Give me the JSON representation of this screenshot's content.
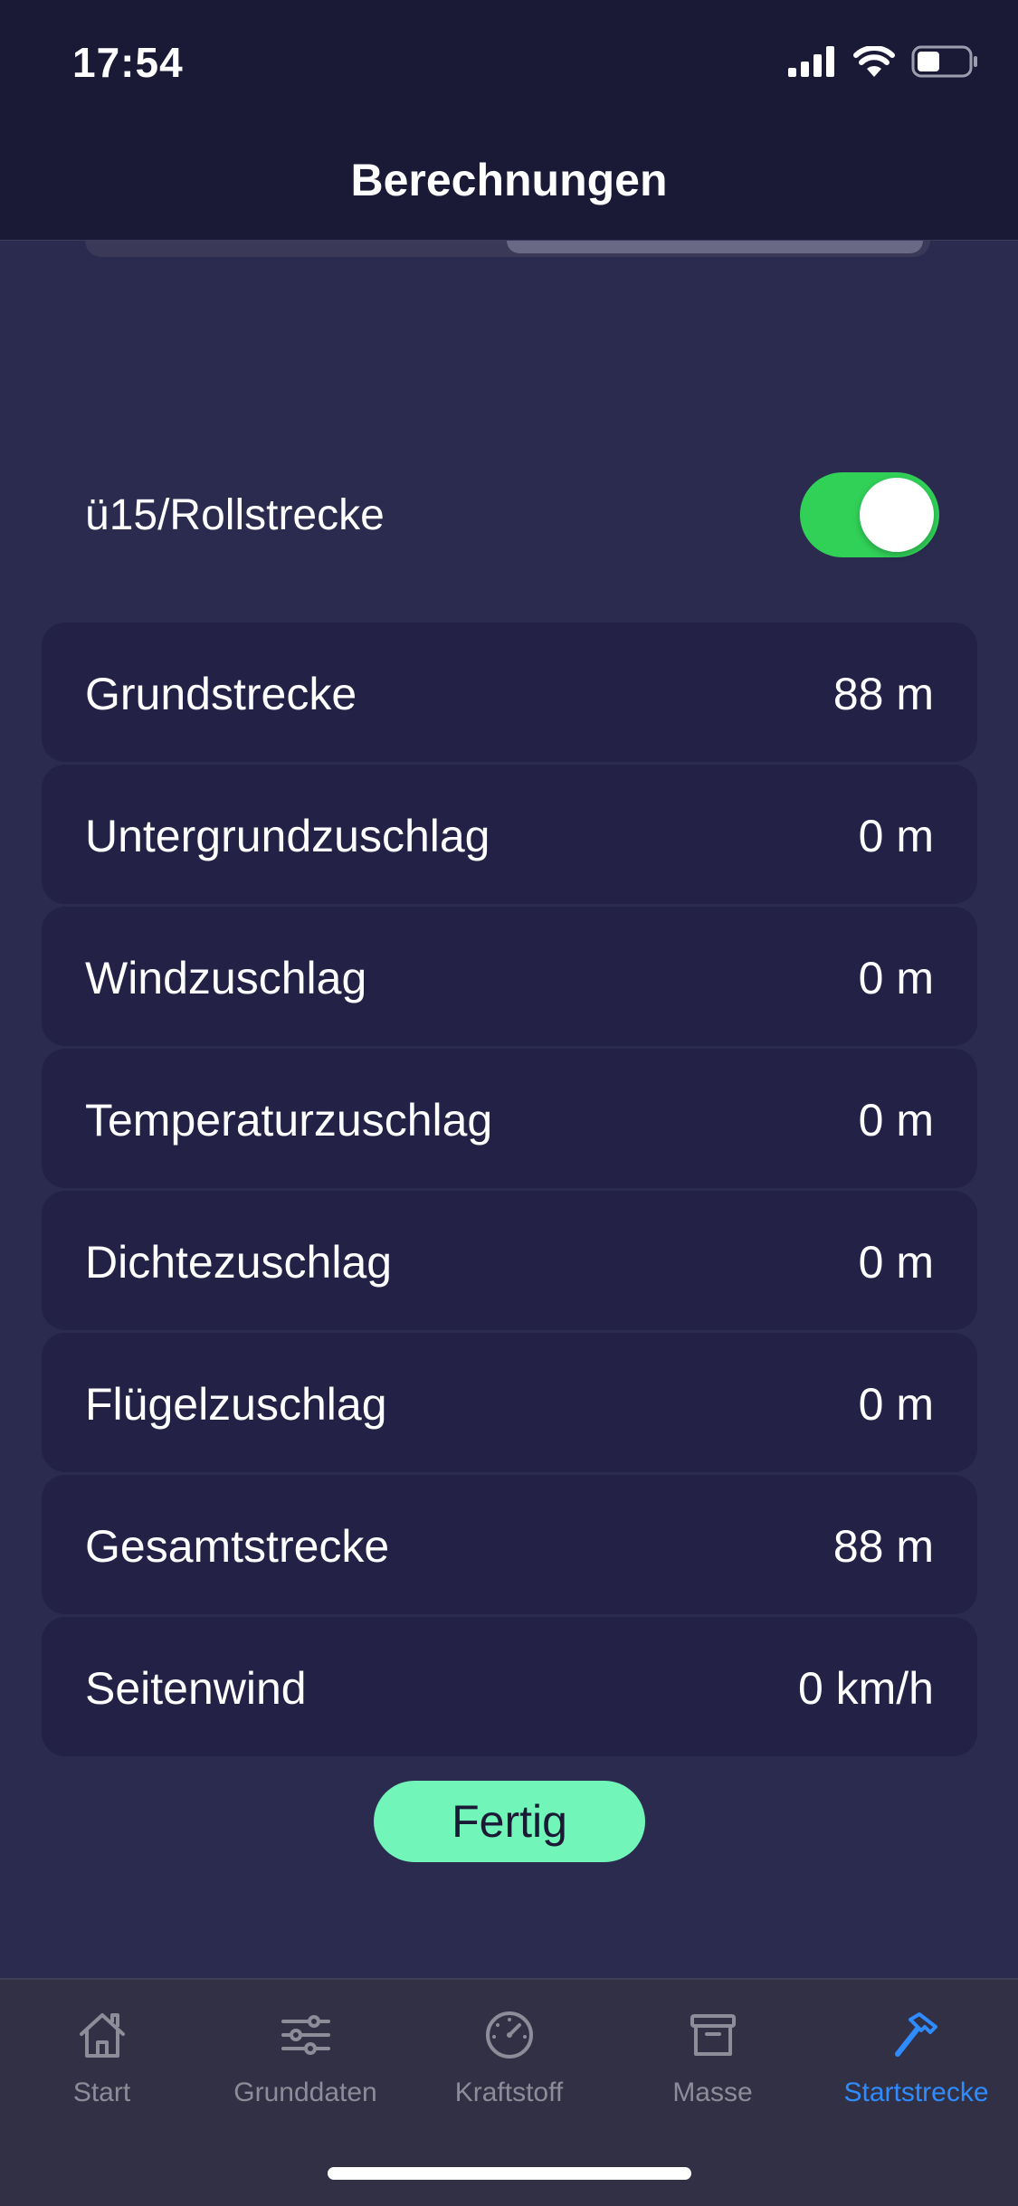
{
  "status_bar": {
    "time": "17:54",
    "icons": [
      "cellular-signal-icon",
      "wifi-icon",
      "battery-icon"
    ]
  },
  "nav": {
    "title": "Berechnungen"
  },
  "toggle": {
    "label": "ü15/Rollstrecke",
    "on": true
  },
  "results": [
    {
      "label": "Grundstrecke",
      "value": "88 m"
    },
    {
      "label": "Untergrundzuschlag",
      "value": "0 m"
    },
    {
      "label": "Windzuschlag",
      "value": "0 m"
    },
    {
      "label": "Temperaturzuschlag",
      "value": "0 m"
    },
    {
      "label": "Dichtezuschlag",
      "value": "0 m"
    },
    {
      "label": "Flügelzuschlag",
      "value": "0 m"
    },
    {
      "label": "Gesamtstrecke",
      "value": "88 m"
    },
    {
      "label": "Seitenwind",
      "value": "0 km/h"
    }
  ],
  "done_button": {
    "label": "Fertig"
  },
  "tabs": [
    {
      "label": "Start",
      "icon": "home-icon",
      "active": false
    },
    {
      "label": "Grunddaten",
      "icon": "sliders-icon",
      "active": false
    },
    {
      "label": "Kraftstoff",
      "icon": "gauge-icon",
      "active": false
    },
    {
      "label": "Masse",
      "icon": "archive-box-icon",
      "active": false
    },
    {
      "label": "Startstrecke",
      "icon": "hammer-icon",
      "active": true
    }
  ],
  "colors": {
    "background": "#2b2a4f",
    "bar_background": "#1b1a36",
    "row_background": "#232246",
    "toggle_on": "#31d158",
    "button": "#72f5b8",
    "tab_active": "#2f8cff",
    "tab_inactive": "#8d8c99"
  }
}
